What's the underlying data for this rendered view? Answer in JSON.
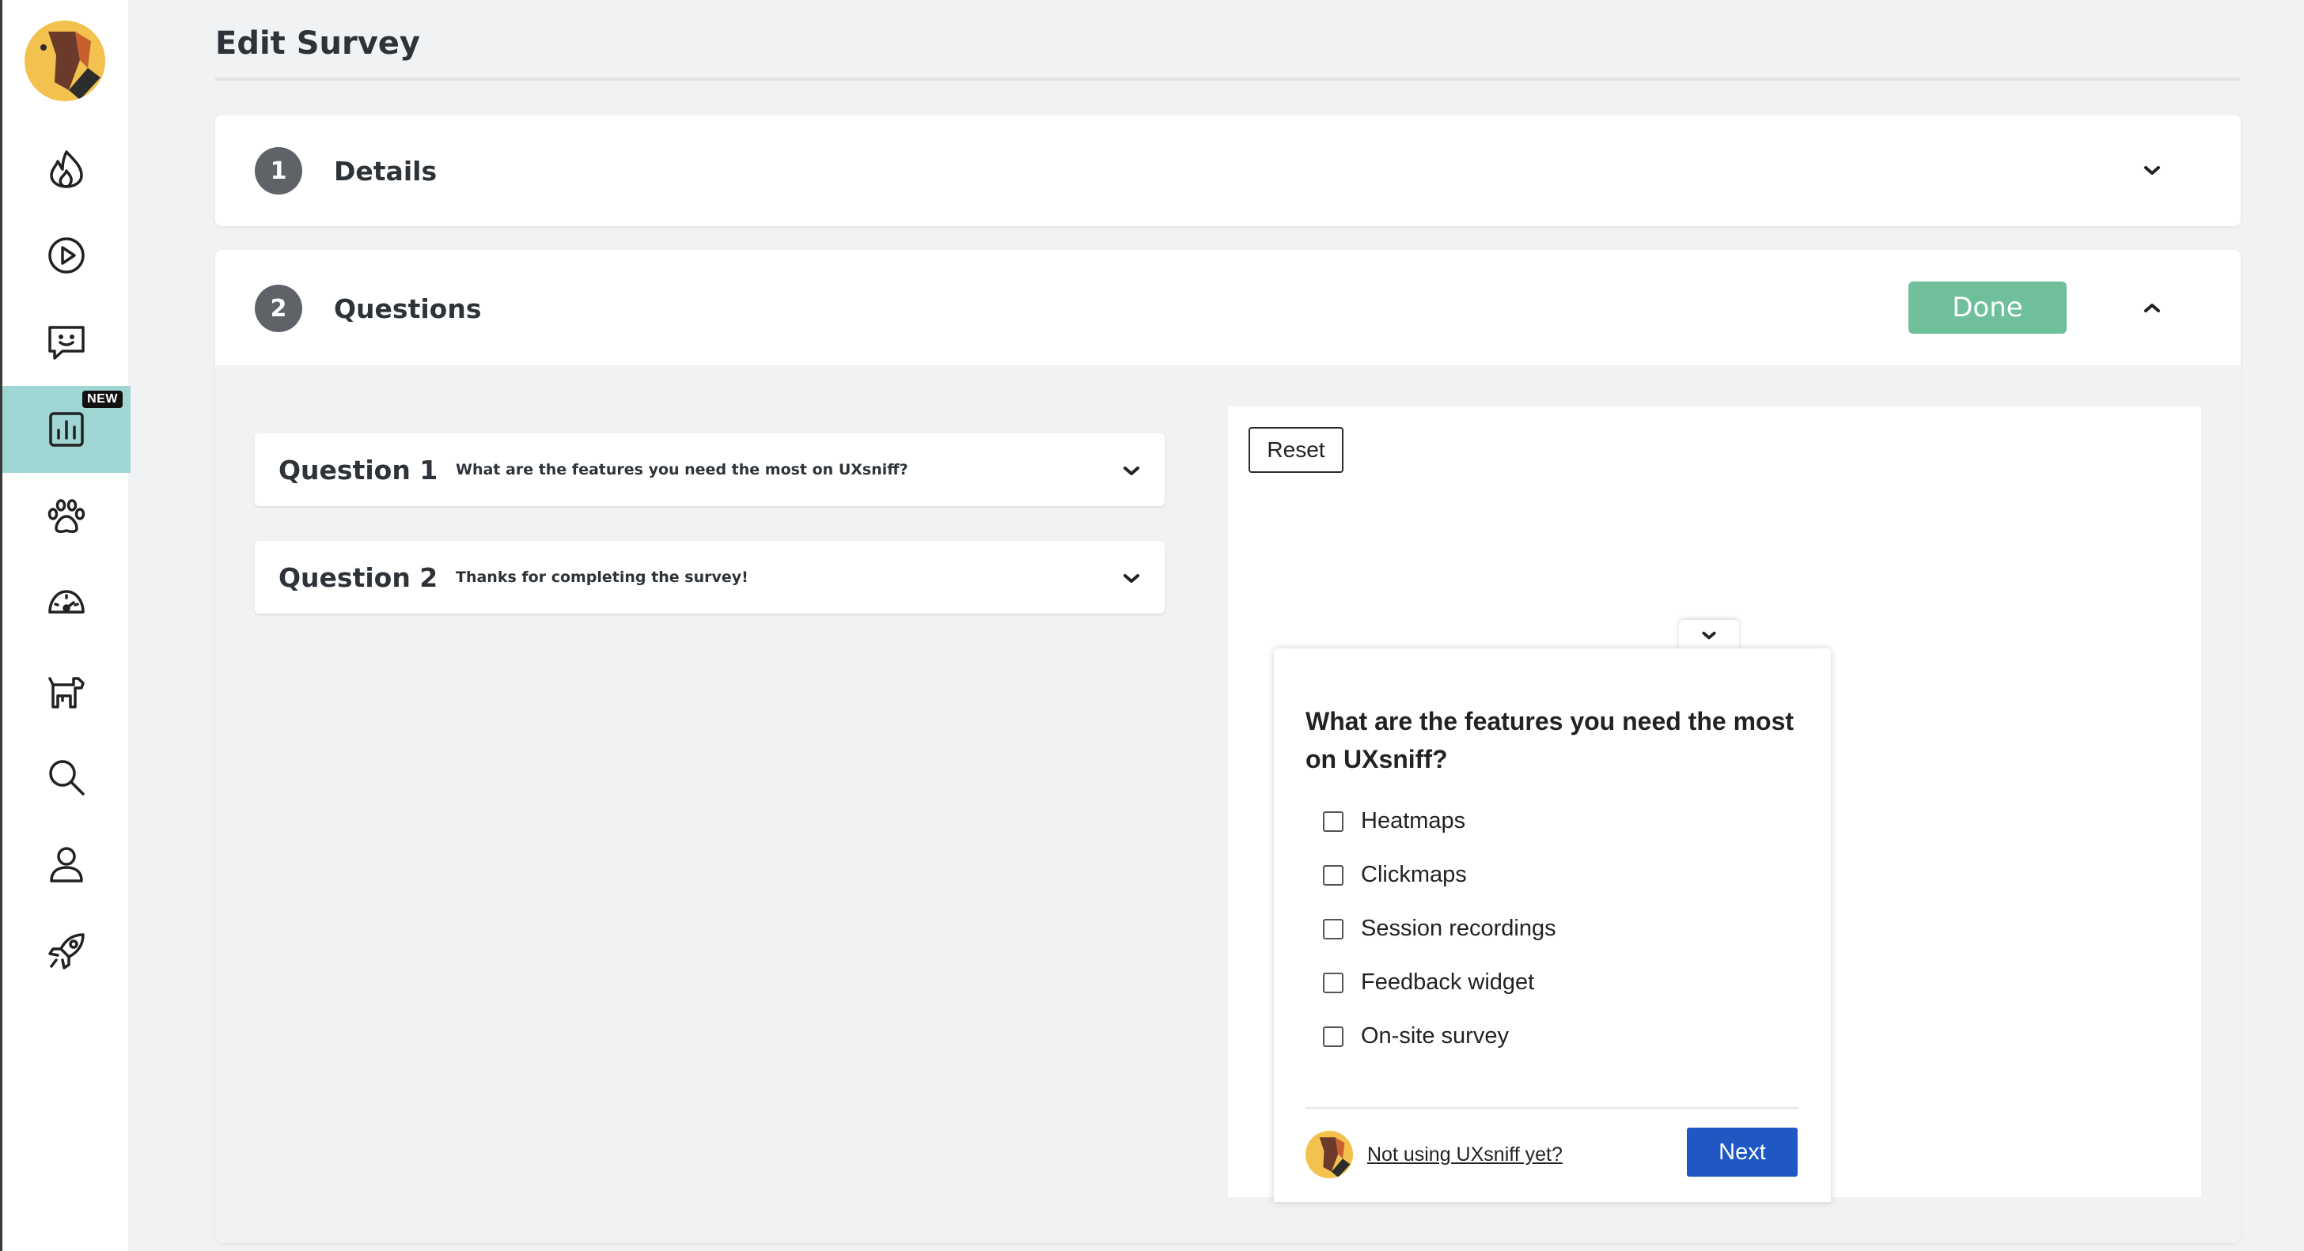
{
  "page": {
    "title": "Edit Survey"
  },
  "sidebar": {
    "items": [
      {
        "icon": "fire-icon"
      },
      {
        "icon": "play-icon"
      },
      {
        "icon": "feedback-chat-icon"
      },
      {
        "icon": "chart-icon",
        "active": true,
        "badge": "NEW"
      },
      {
        "icon": "paw-icon"
      },
      {
        "icon": "speedometer-icon"
      },
      {
        "icon": "dog-icon"
      },
      {
        "icon": "search-icon"
      },
      {
        "icon": "user-icon"
      },
      {
        "icon": "rocket-icon"
      }
    ]
  },
  "steps": {
    "details": {
      "number": "1",
      "label": "Details"
    },
    "questions": {
      "number": "2",
      "label": "Questions",
      "done_label": "Done"
    }
  },
  "questions": [
    {
      "title": "Question 1",
      "text": "What are the features you need the most on UXsniff?"
    },
    {
      "title": "Question 2",
      "text": "Thanks for completing the survey!"
    }
  ],
  "preview": {
    "reset_label": "Reset",
    "question": "What are the features you need the most on UXsniff?",
    "options": [
      "Heatmaps",
      "Clickmaps",
      "Session recordings",
      "Feedback widget",
      "On-site survey"
    ],
    "footer_link": "Not using UXsniff yet?",
    "next_label": "Next"
  },
  "colors": {
    "accent_active": "#9fd6d4",
    "done": "#6fbf9a",
    "next": "#1f57c3",
    "logo": "#f2c14e"
  }
}
